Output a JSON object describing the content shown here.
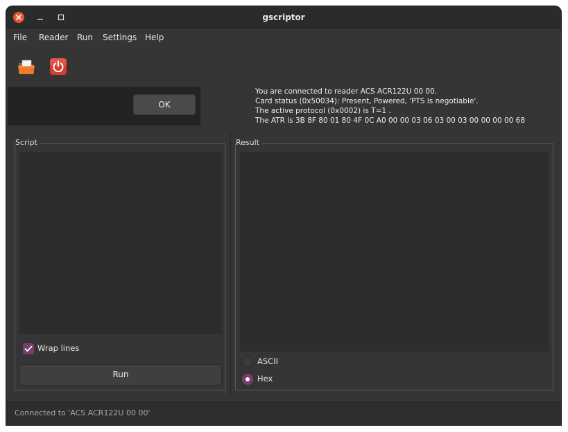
{
  "window": {
    "title": "gscriptor"
  },
  "menu": {
    "items": [
      "File",
      "Reader",
      "Run",
      "Settings",
      "Help"
    ]
  },
  "toolbar": {
    "buttons": [
      {
        "icon": "open-folder-icon",
        "color": "#e8732c"
      },
      {
        "icon": "power-icon",
        "color": "#d63b2f"
      }
    ]
  },
  "dialog": {
    "ok_label": "OK"
  },
  "info": {
    "lines": [
      "You are connected to reader ACS ACR122U 00 00.",
      "Card status (0x50034): Present, Powered, 'PTS is negotiable'.",
      "The active protocol (0x0002) is T=1 .",
      "The ATR is 3B 8F 80 01 80 4F 0C A0 00 00 03 06 03 00 03 00 00 00 00 68"
    ]
  },
  "script": {
    "label": "Script",
    "content": "",
    "wrap_lines_label": "Wrap lines",
    "wrap_lines_checked": true,
    "run_label": "Run"
  },
  "result": {
    "label": "Result",
    "content": "",
    "options": [
      {
        "label": "ASCII",
        "selected": false
      },
      {
        "label": "Hex",
        "selected": true
      }
    ]
  },
  "status": {
    "text": "Connected to 'ACS ACR122U 00 00'"
  },
  "colors": {
    "accent": "#7a3d6f",
    "close_button": "#e9542c",
    "window_bg": "#353535"
  }
}
